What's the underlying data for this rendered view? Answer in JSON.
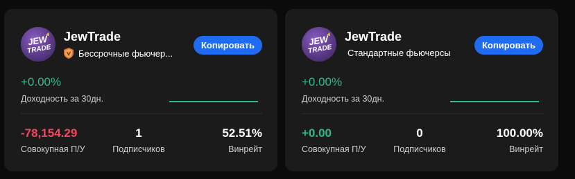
{
  "cards": [
    {
      "name": "JewTrade",
      "avatar_text": "JEW TRADE",
      "type_label": "Бессрочные фьючер...",
      "copy_label": "Копировать",
      "pnl_percent": "+0.00%",
      "pnl_percent_label": "Доходность за 30дн.",
      "total_pnl": "-78,154.29",
      "total_pnl_label": "Совокупная П/У",
      "subscribers": "1",
      "subscribers_label": "Подписчиков",
      "winrate": "52.51%",
      "winrate_label": "Винрейт"
    },
    {
      "name": "JewTrade",
      "avatar_text": "JEW TRADE",
      "type_label": "Стандартные фьючерсы",
      "copy_label": "Копировать",
      "pnl_percent": "+0.00%",
      "pnl_percent_label": "Доходность за 30дн.",
      "total_pnl": "+0.00",
      "total_pnl_label": "Совокупная П/У",
      "subscribers": "0",
      "subscribers_label": "Подписчиков",
      "winrate": "100.00%",
      "winrate_label": "Винрейт"
    }
  ],
  "colors": {
    "positive": "#2ebd85",
    "negative": "#f6465d",
    "accent": "#1f6bf2",
    "card_bg": "#1b1b1c"
  }
}
